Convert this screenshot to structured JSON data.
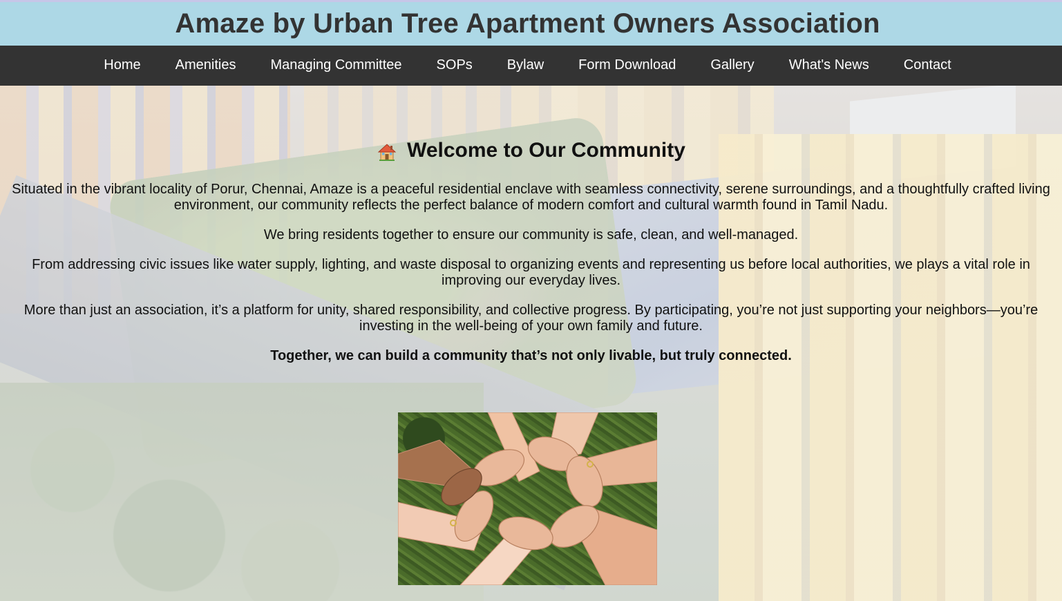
{
  "header": {
    "title": "Amaze by Urban Tree Apartment Owners Association"
  },
  "nav": {
    "items": [
      {
        "label": "Home"
      },
      {
        "label": "Amenities"
      },
      {
        "label": "Managing Committee"
      },
      {
        "label": "SOPs"
      },
      {
        "label": "Bylaw"
      },
      {
        "label": "Form Download"
      },
      {
        "label": "Gallery"
      },
      {
        "label": "What's News"
      },
      {
        "label": "Contact"
      }
    ]
  },
  "main": {
    "heading_icon": "house-icon",
    "heading": "Welcome to Our Community",
    "paragraphs": [
      "Situated in the vibrant locality of Porur, Chennai, Amaze is a peaceful residential enclave with seamless connectivity, serene surroundings, and a thoughtfully crafted living environment, our community reflects the perfect balance of modern comfort and cultural warmth found in Tamil Nadu.",
      "We bring residents together to ensure our community is safe, clean, and well-managed.",
      "From addressing civic issues like water supply, lighting, and waste disposal to organizing events and representing us before local authorities, we plays a vital role in improving our everyday lives.",
      "More than just an association, it’s a platform for unity, shared responsibility, and collective progress. By participating, you’re not just supporting your neighbors—you’re investing in the well-being of your own family and future."
    ],
    "closing": "Together, we can build a community that’s not only livable, but truly connected."
  },
  "colors": {
    "header_bg": "#add8e6",
    "title_text": "#333333",
    "nav_bg": "#333333",
    "nav_text": "#ffffff"
  }
}
